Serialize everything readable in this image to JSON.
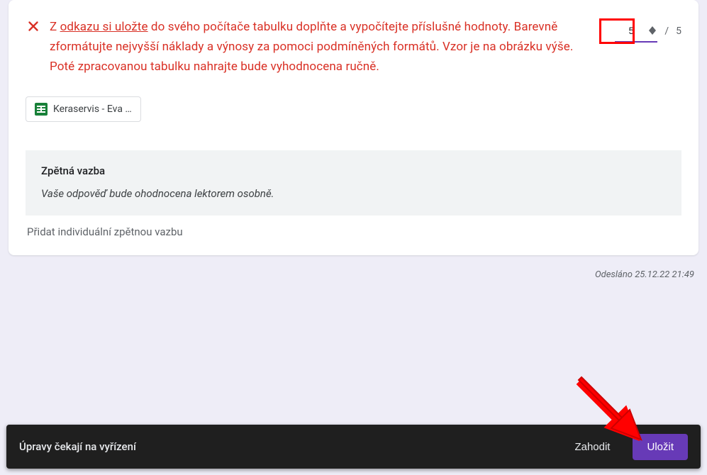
{
  "question": {
    "text_pre": "Z ",
    "link_text": "odkazu si uložte",
    "text_post": " do svého počítače tabulku doplňte a vypočítejte příslušné hodnoty. Barevně zformátujte nejvyšší náklady a výnosy za pomoci podmíněných formátů. Vzor je na obrázku výše. Poté zpracovanou tabulku nahrajte bude vyhodnocena ručně."
  },
  "score": {
    "value": "5",
    "separator": "/",
    "max": "5"
  },
  "attachment": {
    "label": "Keraservis - Eva …"
  },
  "feedback": {
    "title": "Zpětná vazba",
    "body": "Vaše odpověď bude ohodnocena lektorem osobně."
  },
  "add_feedback": "Přidat individuální zpětnou vazbu",
  "sent": "Odesláno 25.12.22 21:49",
  "bottom_bar": {
    "message": "Úpravy čekají na vyřízení",
    "discard": "Zahodit",
    "save": "Uložit"
  }
}
